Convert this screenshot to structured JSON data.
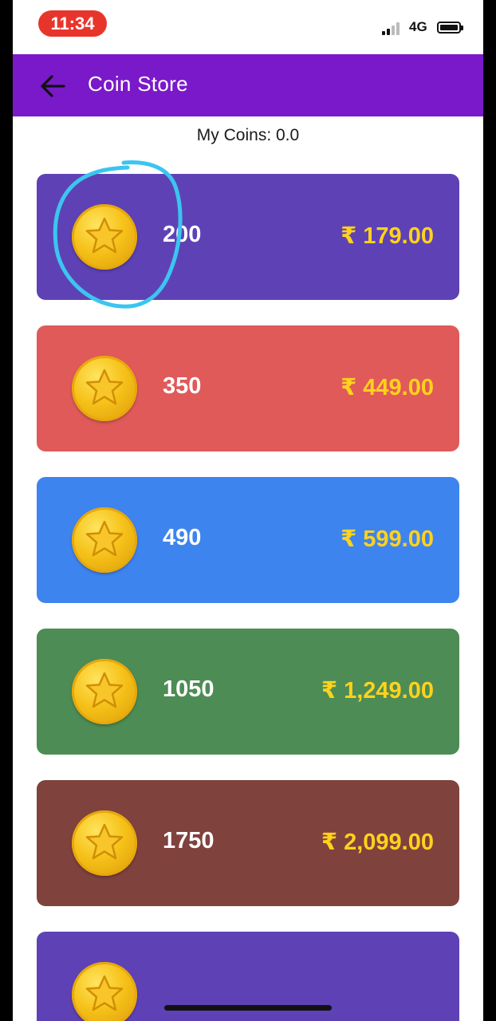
{
  "status_bar": {
    "time": "11:34",
    "network": "4G"
  },
  "header": {
    "title": "Coin Store"
  },
  "balance": {
    "text": "My Coins: 0.0"
  },
  "packages": [
    {
      "coins": "200",
      "price": "₹ 179.00",
      "color": "#5e42b5",
      "selected": true
    },
    {
      "coins": "350",
      "price": "₹ 449.00",
      "color": "#e05a5a"
    },
    {
      "coins": "490",
      "price": "₹ 599.00",
      "color": "#3e84ef"
    },
    {
      "coins": "1050",
      "price": "₹ 1,249.00",
      "color": "#4d8c55"
    },
    {
      "coins": "1750",
      "price": "₹ 2,099.00",
      "color": "#80423d"
    },
    {
      "coins": "",
      "price": "",
      "color": "#5e42b5"
    }
  ],
  "colors": {
    "app_bar": "#7a19c9",
    "price_text": "#ffd21c",
    "time_pill": "#e8352b",
    "annotation": "#3bc5ef"
  },
  "icons": {
    "back": "arrow-left-icon",
    "coin": "star-coin-icon"
  }
}
